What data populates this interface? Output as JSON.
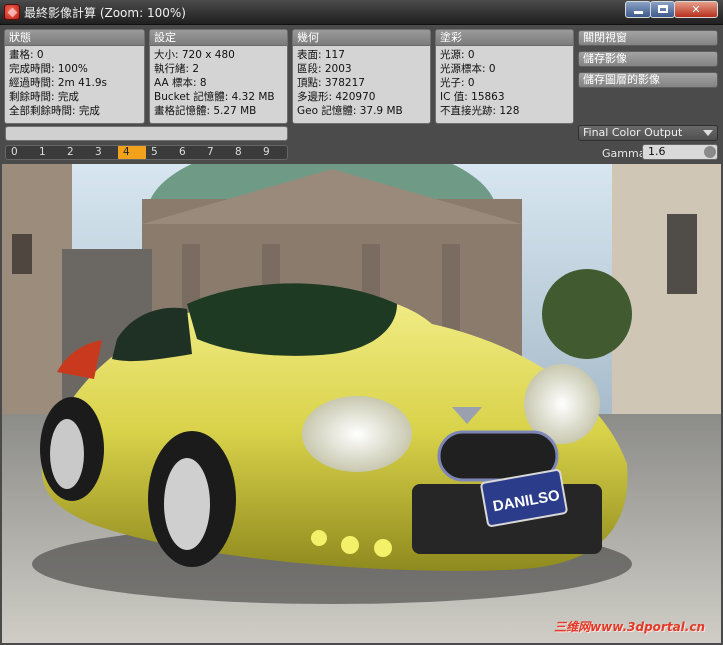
{
  "window": {
    "title": "最終影像計算 (Zoom: 100%)"
  },
  "status": {
    "header": "狀態",
    "rows": [
      "畫格: 0",
      "完成時間: 100%",
      "經過時間: 2m 41.9s",
      "剩餘時間: 完成",
      "全部剩餘時間: 完成"
    ]
  },
  "settings": {
    "header": "設定",
    "rows": [
      "大小: 720 x 480",
      "執行緒: 2",
      "AA 標本: 8",
      "Bucket 記憶體: 4.32 MB",
      "畫格記憶體: 5.27 MB"
    ]
  },
  "geometry": {
    "header": "幾何",
    "rows": [
      "表面: 117",
      "區段: 2003",
      "頂點: 378217",
      "多邊形: 420970",
      "Geo 記憶體: 37.9 MB"
    ]
  },
  "lighting": {
    "header": "塗彩",
    "rows": [
      "光源: 0",
      "光源標本: 0",
      "光子: 0",
      "IC 值: 15863",
      "不直接光跡: 128"
    ]
  },
  "actions": {
    "close_view": "關閉視窗",
    "save_image": "儲存影像",
    "save_layers": "儲存圖層的影像"
  },
  "layer_tabs": {
    "items": [
      "0",
      "1",
      "2",
      "3",
      "4",
      "5",
      "6",
      "7",
      "8",
      "9"
    ],
    "active": "4"
  },
  "output": {
    "selected": "Final Color Output"
  },
  "gamma": {
    "label": "Gamma",
    "value": "1.6"
  },
  "render": {
    "plate_text": "DANILSO",
    "watermark": "三维网www.3dportal.cn",
    "car_color": "#d9d24a",
    "sky_color": "#d7e6f0"
  },
  "colors": {
    "accent": "#f2a21a",
    "close": "#c23a25",
    "panel": "#d4d4d4"
  }
}
